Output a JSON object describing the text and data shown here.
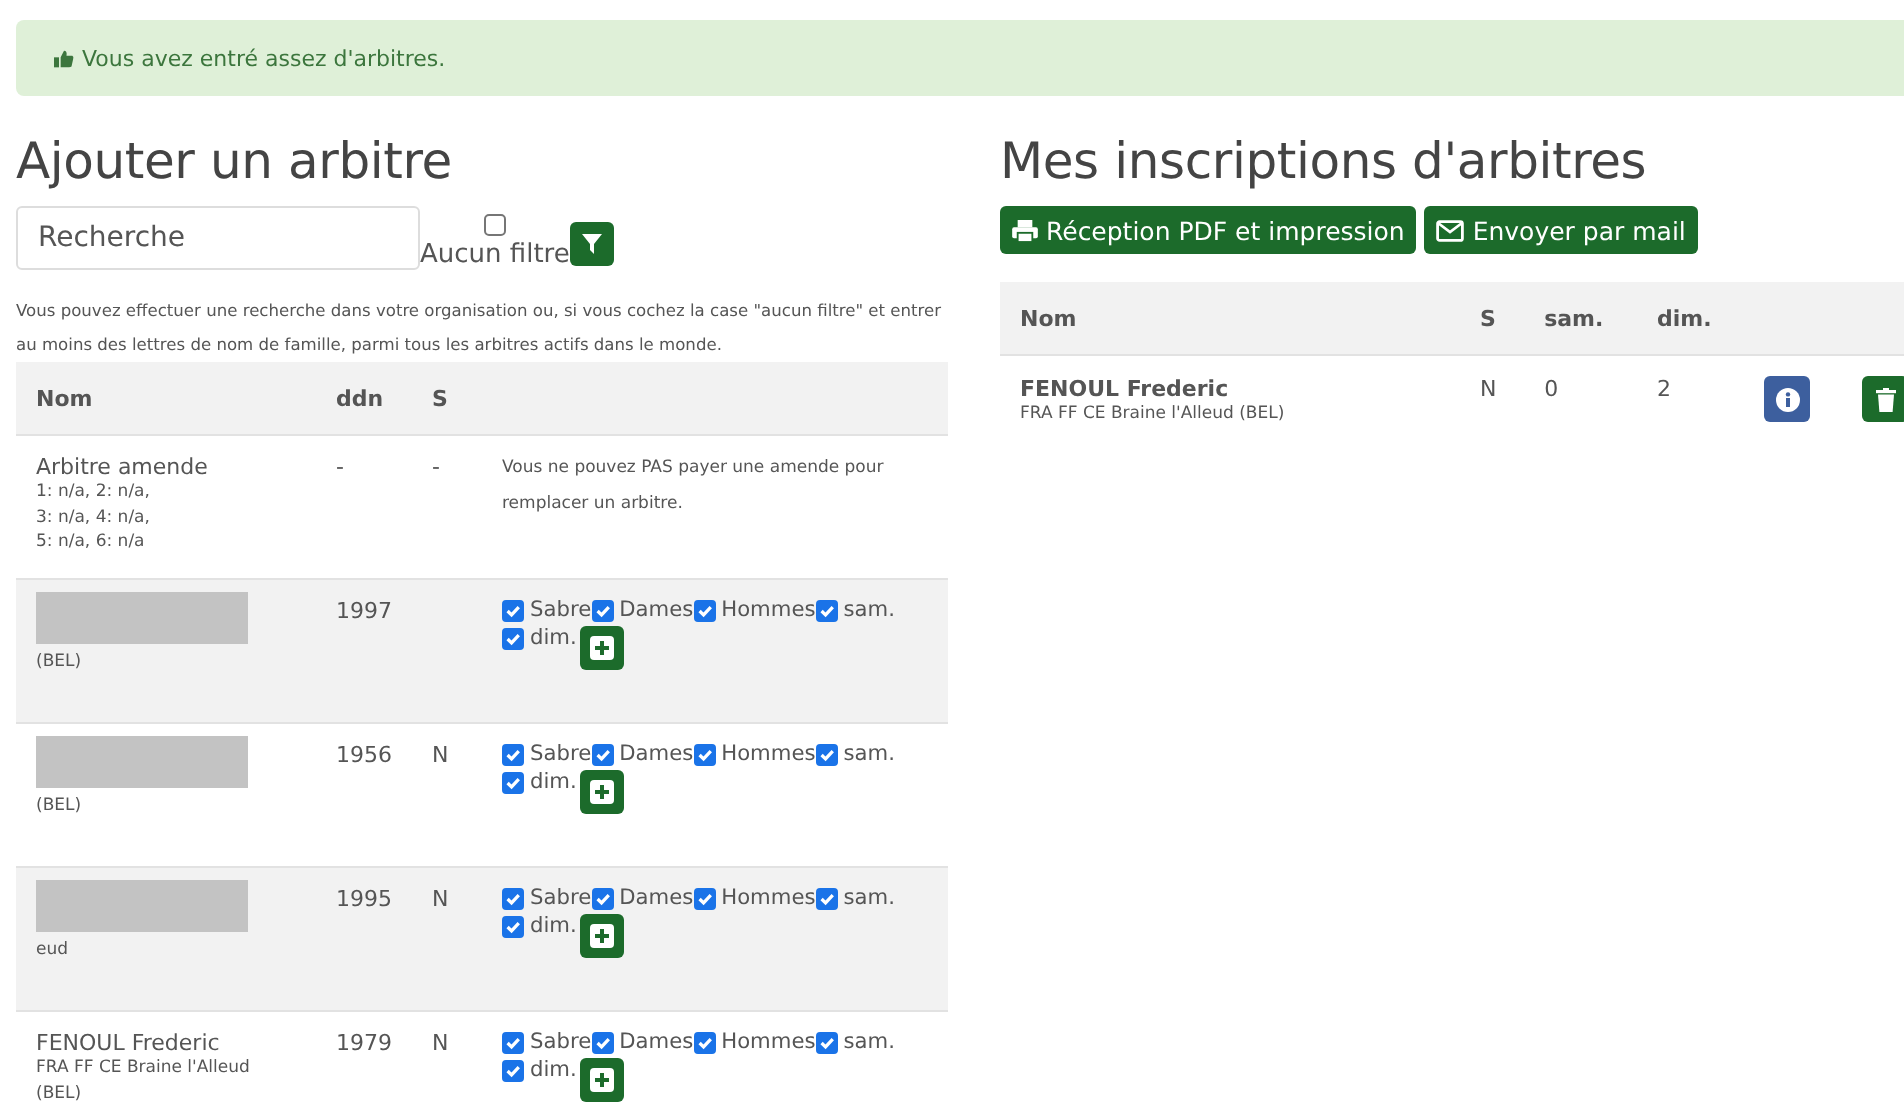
{
  "alert": {
    "text": "Vous avez entré assez d'arbitres."
  },
  "add": {
    "title": "Ajouter un arbitre",
    "search": {
      "placeholder": "Recherche"
    },
    "no_filter": {
      "label": "Aucun filtre",
      "checked": false
    },
    "help": "Vous pouvez effectuer une recherche dans votre organisation ou, si vous cochez la case \"aucun filtre\" et entrer au moins des lettres de nom de famille, parmi tous les arbitres actifs dans le monde.",
    "columns": [
      "Nom",
      "ddn",
      "S"
    ],
    "rows": [
      {
        "kind": "fine",
        "name": "Arbitre amende",
        "lines": [
          "1: n/a, 2: n/a,",
          "3: n/a, 4: n/a,",
          "5: n/a, 6: n/a"
        ],
        "ddn": "-",
        "s": "-",
        "note": "Vous ne pouvez PAS payer une amende pour remplacer un arbitre."
      },
      {
        "kind": "referee",
        "redacted": true,
        "lines": [
          "(BEL)"
        ],
        "ddn": "1997",
        "options": [
          {
            "label": "Sabre",
            "checked": true
          },
          {
            "label": "Dames",
            "checked": true
          },
          {
            "label": "Hommes",
            "checked": true
          },
          {
            "label": "sam.",
            "checked": true
          },
          {
            "label": "dim.",
            "checked": true
          }
        ]
      },
      {
        "kind": "referee",
        "redacted": true,
        "lines": [
          "(BEL)"
        ],
        "ddn": "1956",
        "s": "N",
        "options": [
          {
            "label": "Sabre",
            "checked": true
          },
          {
            "label": "Dames",
            "checked": true
          },
          {
            "label": "Hommes",
            "checked": true
          },
          {
            "label": "sam.",
            "checked": true
          },
          {
            "label": "dim.",
            "checked": true
          }
        ]
      },
      {
        "kind": "referee",
        "redacted": true,
        "lines": [
          "eud"
        ],
        "ddn": "1995",
        "s": "N",
        "options": [
          {
            "label": "Sabre",
            "checked": true
          },
          {
            "label": "Dames",
            "checked": true
          },
          {
            "label": "Hommes",
            "checked": true
          },
          {
            "label": "sam.",
            "checked": true
          },
          {
            "label": "dim.",
            "checked": true
          }
        ]
      },
      {
        "kind": "referee",
        "redacted": false,
        "name": "FENOUL Frederic",
        "lines": [
          "FRA FF CE Braine l'Alleud",
          "(BEL)"
        ],
        "ddn": "1979",
        "s": "N",
        "options": [
          {
            "label": "Sabre",
            "checked": true
          },
          {
            "label": "Dames",
            "checked": true
          },
          {
            "label": "Hommes",
            "checked": true
          },
          {
            "label": "sam.",
            "checked": true
          },
          {
            "label": "dim.",
            "checked": true
          }
        ]
      }
    ]
  },
  "mine": {
    "title": "Mes inscriptions d'arbitres",
    "buttons": [
      {
        "kind": "print",
        "label": "Réception PDF et impression"
      },
      {
        "kind": "mail",
        "label": "Envoyer par mail"
      }
    ],
    "columns": [
      "Nom",
      "S",
      "sam.",
      "dim."
    ],
    "rows": [
      {
        "name": "FENOUL Frederic",
        "club": "FRA FF CE Braine l'Alleud (BEL)",
        "s": "N",
        "sam": "0",
        "dim": "2"
      }
    ]
  }
}
